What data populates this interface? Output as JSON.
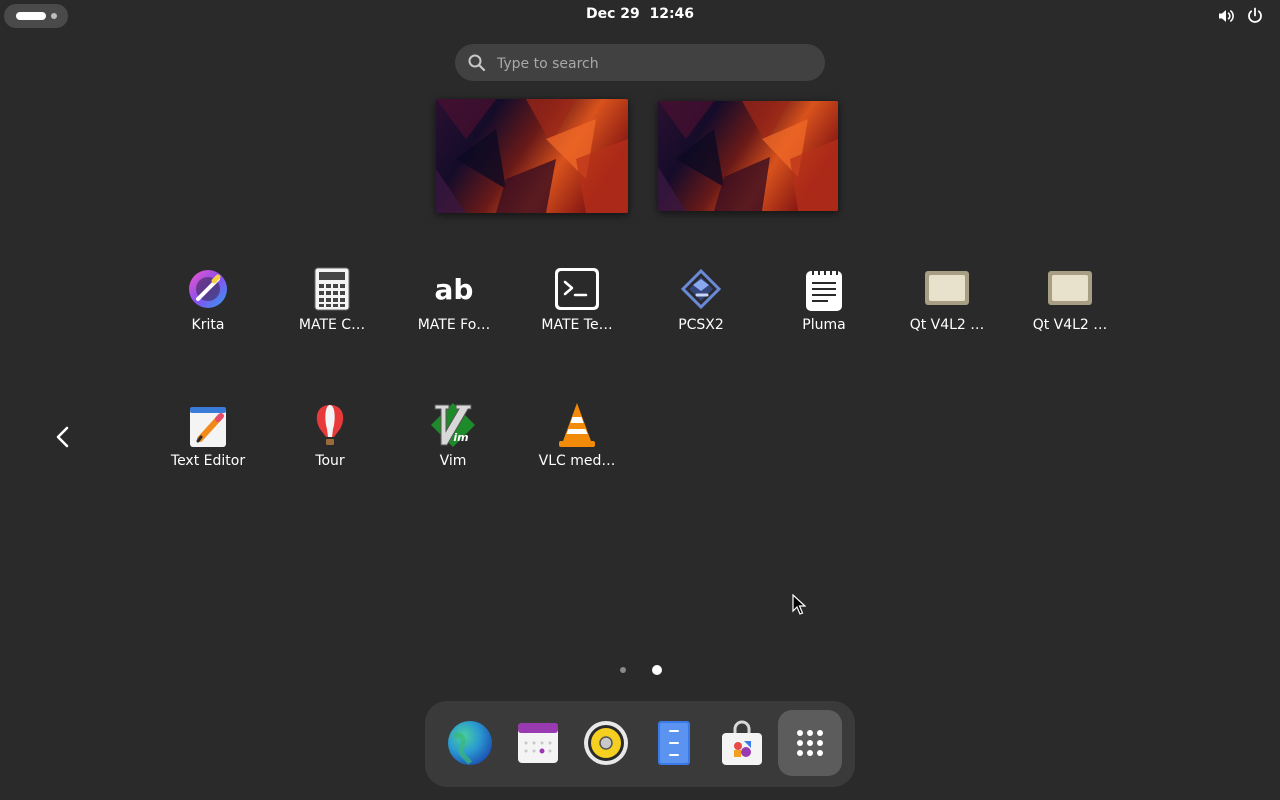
{
  "topbar": {
    "clock": "Dec 29  12:46",
    "icons": [
      "activities-indicator",
      "volume-icon",
      "power-icon"
    ]
  },
  "search": {
    "placeholder": "Type to search",
    "value": ""
  },
  "workspaces": [
    {
      "name": "workspace-1"
    },
    {
      "name": "workspace-2"
    }
  ],
  "apps": [
    {
      "label": "Krita",
      "icon": "krita-icon"
    },
    {
      "label": "MATE C…",
      "icon": "calculator-icon"
    },
    {
      "label": "MATE Fo…",
      "icon": "font-viewer-icon"
    },
    {
      "label": "MATE Te…",
      "icon": "terminal-icon"
    },
    {
      "label": "PCSX2",
      "icon": "pcsx2-icon"
    },
    {
      "label": "Pluma",
      "icon": "pluma-icon"
    },
    {
      "label": "Qt V4L2 …",
      "icon": "webcam-icon"
    },
    {
      "label": "Qt V4L2 …",
      "icon": "webcam-icon"
    },
    {
      "label": "Text Editor",
      "icon": "text-editor-icon"
    },
    {
      "label": "Tour",
      "icon": "balloon-icon"
    },
    {
      "label": "Vim",
      "icon": "vim-icon"
    },
    {
      "label": "VLC med…",
      "icon": "vlc-cone-icon"
    }
  ],
  "pagination": {
    "pages": 2,
    "current": 2
  },
  "dock": [
    {
      "name": "browser",
      "icon": "globe-icon"
    },
    {
      "name": "calendar",
      "icon": "calendar-icon"
    },
    {
      "name": "music",
      "icon": "speaker-icon"
    },
    {
      "name": "files",
      "icon": "file-cabinet-icon"
    },
    {
      "name": "software",
      "icon": "bag-icon"
    },
    {
      "name": "show-apps",
      "icon": "app-grid-icon"
    }
  ],
  "colors": {
    "background": "#2a2a2a",
    "dock": "#3a3a3a",
    "search": "#414141"
  }
}
